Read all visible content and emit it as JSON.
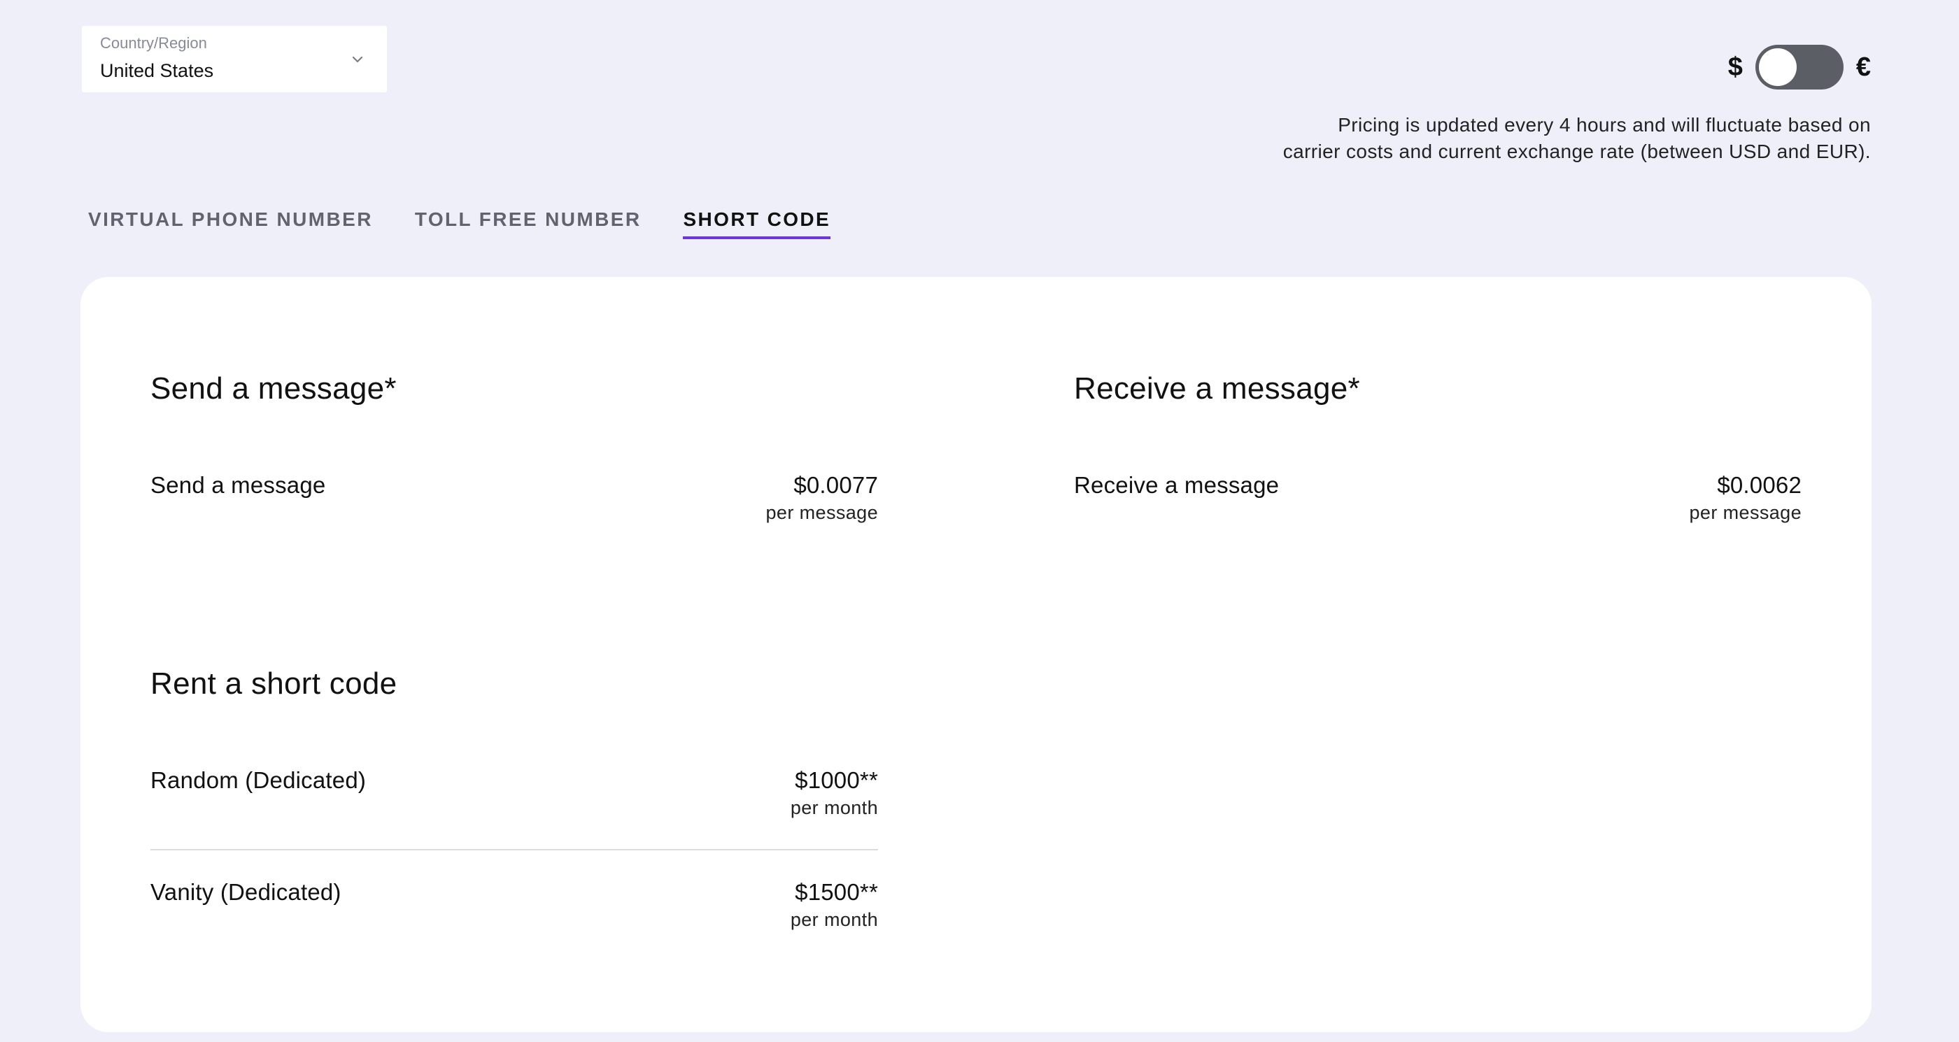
{
  "country_select": {
    "label": "Country/Region",
    "value": "United States",
    "icon": "chevron-down-icon"
  },
  "currency": {
    "usd_symbol": "$",
    "eur_symbol": "€",
    "selected": "USD"
  },
  "pricing_note": {
    "line1": "Pricing is updated every 4 hours and will fluctuate based on",
    "line2": "carrier costs and current exchange rate (between USD and EUR)."
  },
  "tabs": [
    {
      "label": "VIRTUAL PHONE NUMBER",
      "active": false
    },
    {
      "label": "TOLL FREE NUMBER",
      "active": false
    },
    {
      "label": "SHORT CODE",
      "active": true
    }
  ],
  "sections": {
    "send": {
      "title": "Send a message*",
      "rows": [
        {
          "label": "Send a message",
          "price": "$0.0077",
          "unit": "per message"
        }
      ]
    },
    "receive": {
      "title": "Receive a message*",
      "rows": [
        {
          "label": "Receive a message",
          "price": "$0.0062",
          "unit": "per message"
        }
      ]
    },
    "rent": {
      "title": "Rent a short code",
      "rows": [
        {
          "label": "Random (Dedicated)",
          "price": "$1000**",
          "unit": "per month"
        },
        {
          "label": "Vanity (Dedicated)",
          "price": "$1500**",
          "unit": "per month"
        }
      ]
    }
  },
  "colors": {
    "background": "#efeffa",
    "accent": "#6d35d8",
    "switch_track": "#5c5e66"
  }
}
